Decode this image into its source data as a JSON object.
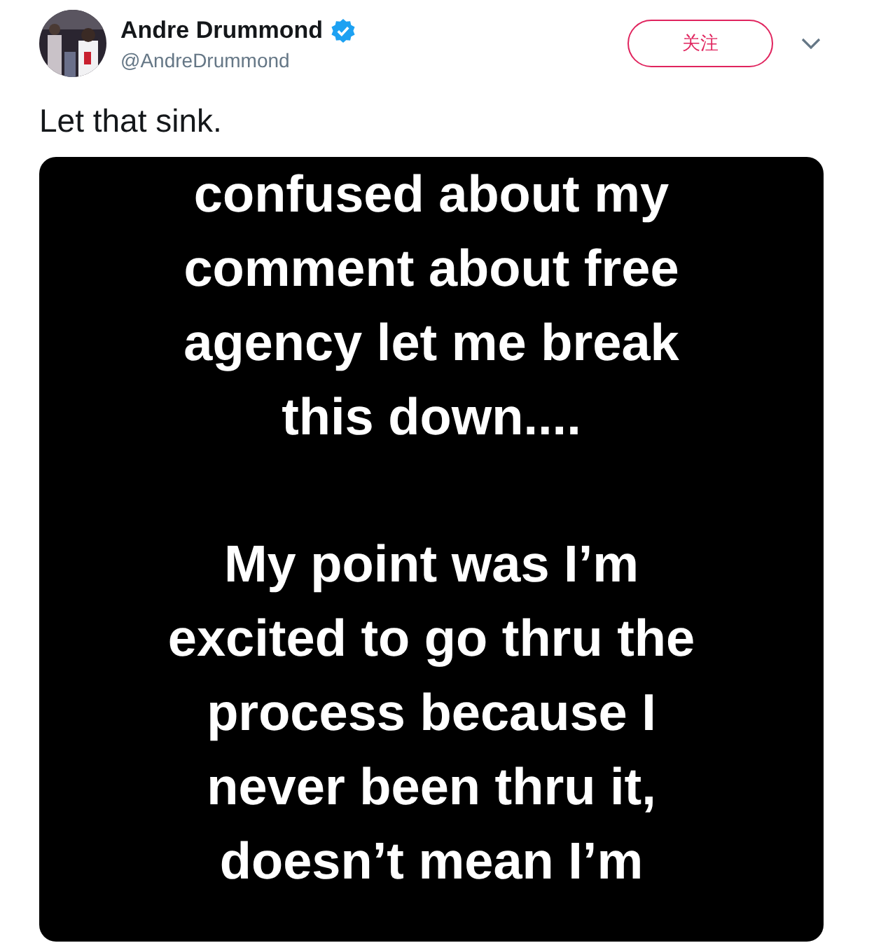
{
  "author": {
    "name": "Andre Drummond",
    "verified": true,
    "handle": "@AndreDrummond"
  },
  "follow_button": {
    "label": "关注"
  },
  "tweet_text": "Let that sink.",
  "media": {
    "paragraphs": [
      [
        "confused about my",
        "comment about free",
        "agency let me break",
        "this down...."
      ],
      [
        "My point was I’m",
        "excited to go thru the",
        "process because I",
        "never been thru it,",
        "doesn’t mean I’m"
      ]
    ]
  }
}
